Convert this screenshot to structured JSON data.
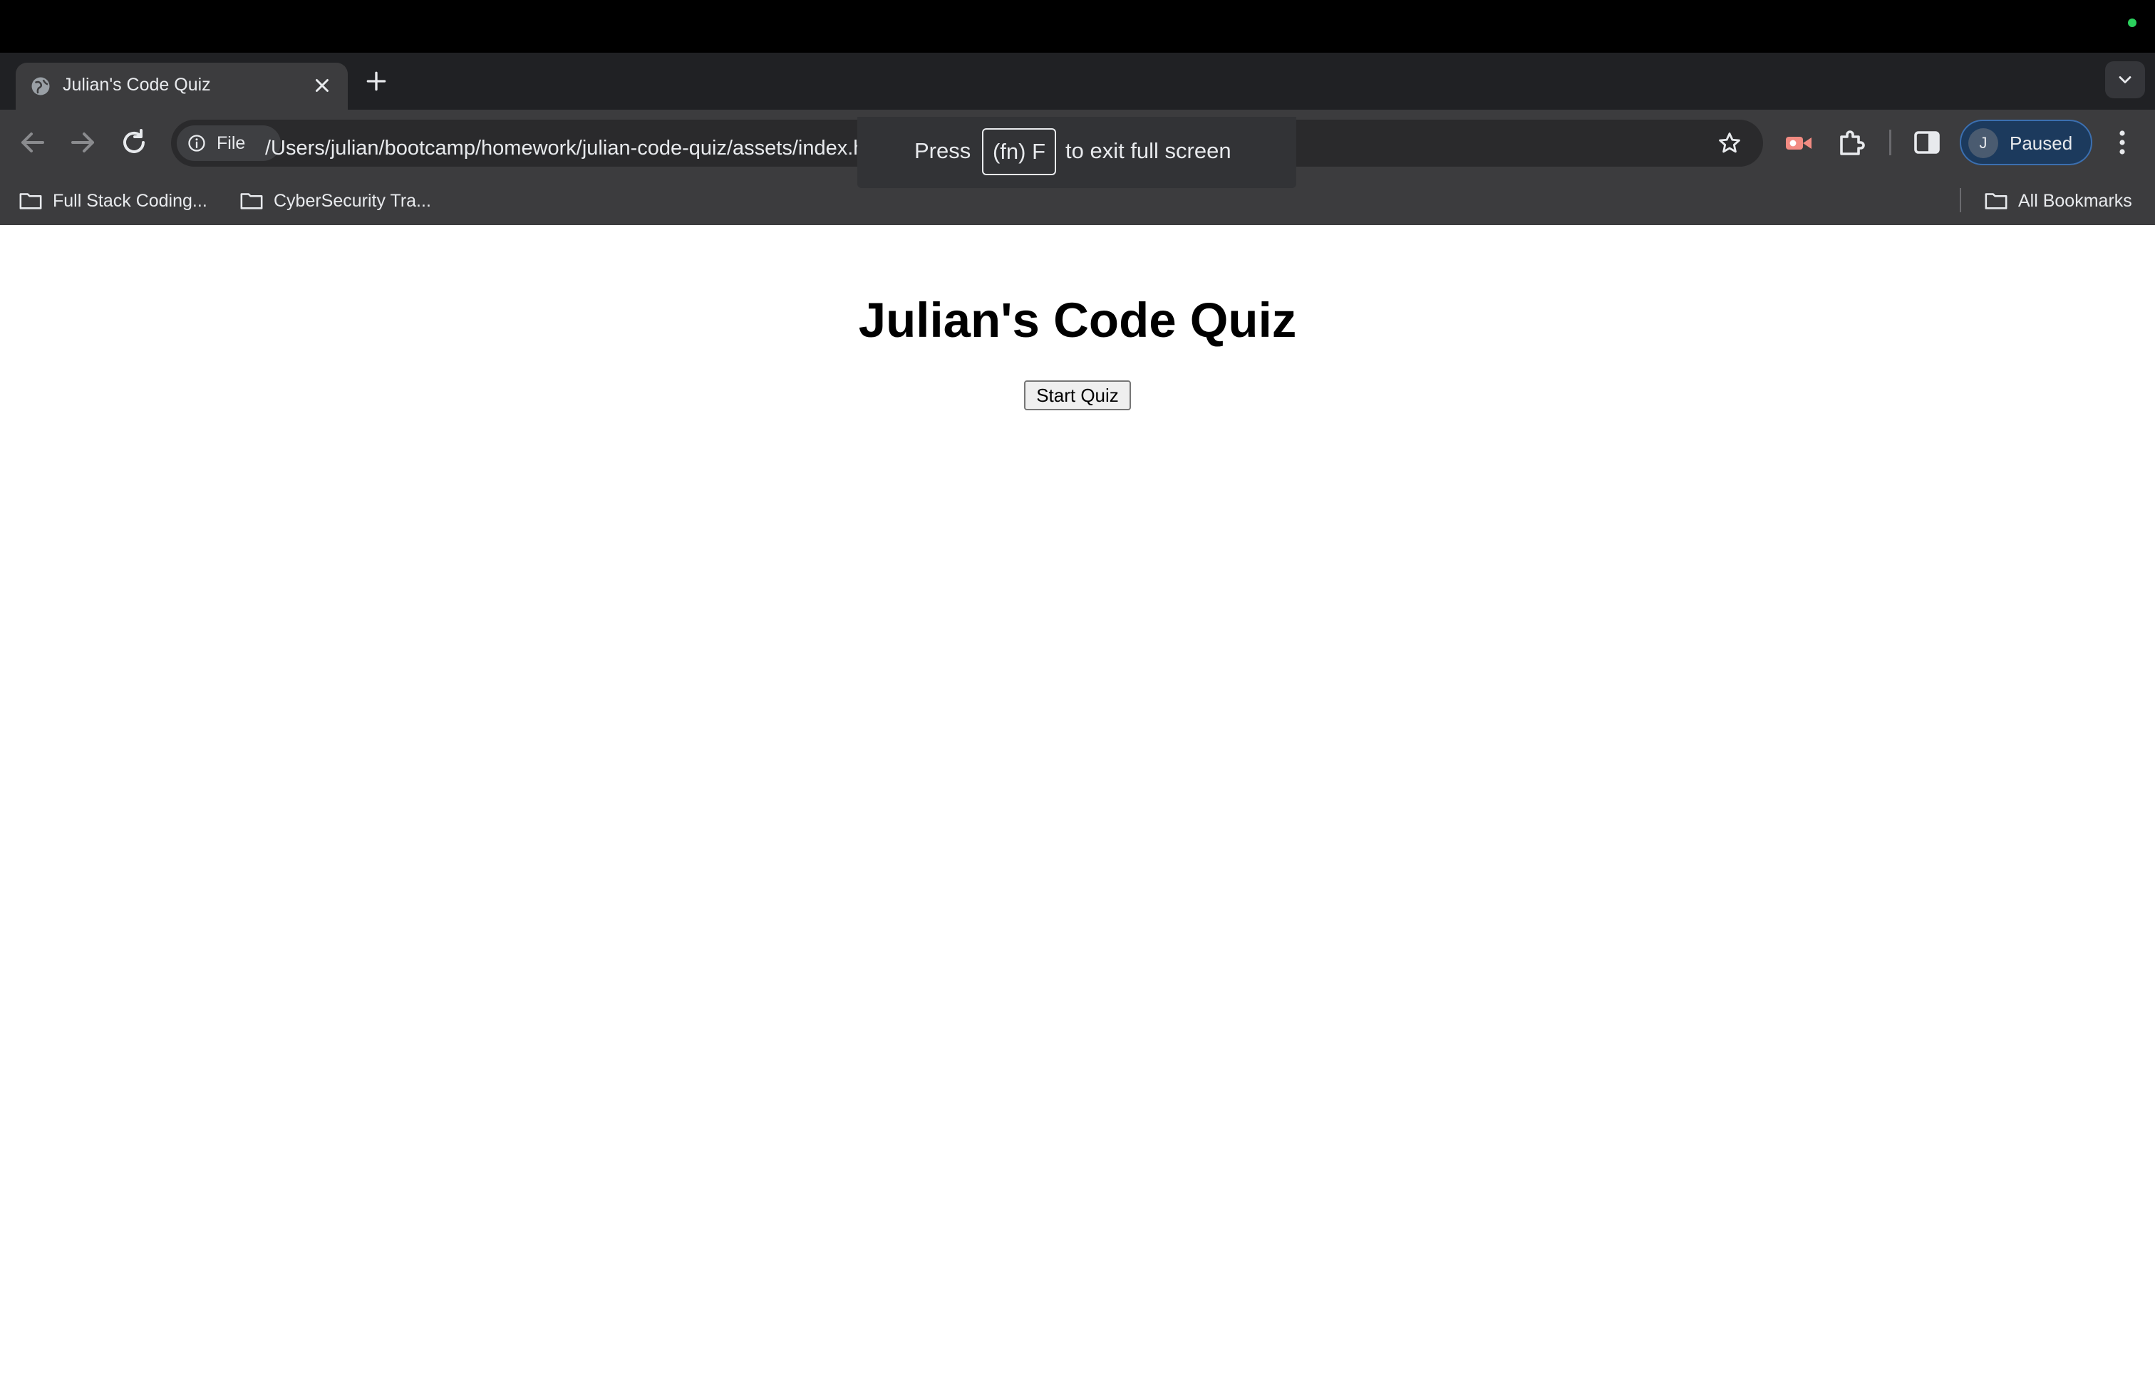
{
  "browser": {
    "tab": {
      "title": "Julian's Code Quiz"
    },
    "toolbar": {
      "site_chip_label": "File",
      "url": "/Users/julian/bootcamp/homework/julian-code-quiz/assets/index.html",
      "profile_initial": "J",
      "profile_status": "Paused"
    },
    "fullscreen_hint": {
      "press": "Press",
      "key": "(fn) F",
      "rest": "to exit full screen"
    },
    "bookmarks": {
      "items": [
        {
          "label": "Full Stack Coding..."
        },
        {
          "label": "CyberSecurity Tra..."
        }
      ],
      "all_bookmarks": "All Bookmarks"
    },
    "colors": {
      "tab_strip": "#202124",
      "toolbar": "#3c3c3e",
      "profile_chip": "#1c3a5d",
      "status_dot": "#2bd15d"
    }
  },
  "page": {
    "title": "Julian's Code Quiz",
    "start_button": "Start Quiz"
  }
}
